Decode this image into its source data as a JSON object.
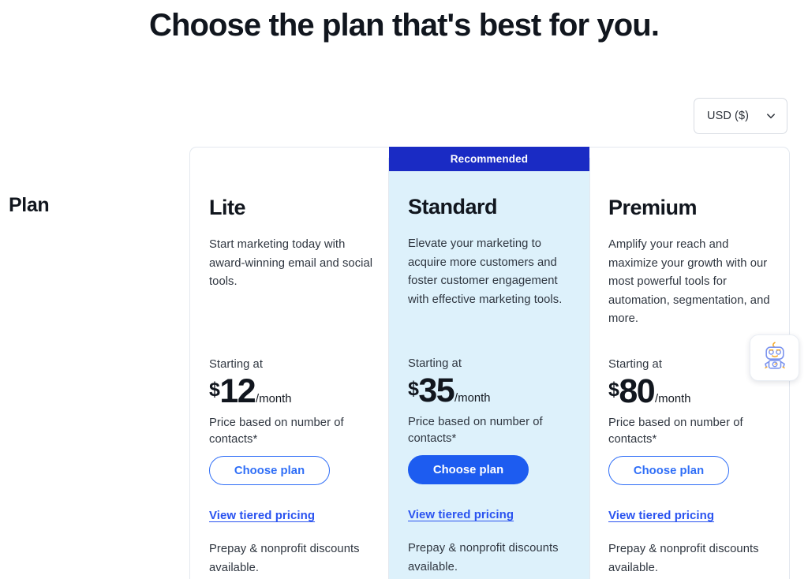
{
  "heading": "Choose the plan that's best for you.",
  "currency": {
    "selected": "USD ($)",
    "icon": "chevron-down-icon"
  },
  "row_label": "Plan",
  "ribbon_label": "Recommended",
  "chat_widget": {
    "icon": "robot-icon"
  },
  "plans": [
    {
      "id": "lite",
      "name": "Lite",
      "description": "Start marketing today with award-winning email and social tools.",
      "starting_at": "Starting at",
      "currency_symbol": "$",
      "amount": "12",
      "per": "/month",
      "price_note": "Price based on number of contacts*",
      "cta_label": "Choose plan",
      "cta_style": "outline",
      "tier_link": "View tiered pricing",
      "discount_note": "Prepay & nonprofit discounts available.",
      "recommended": false
    },
    {
      "id": "standard",
      "name": "Standard",
      "description": "Elevate your marketing to acquire more customers and foster customer engagement with effective marketing tools.",
      "starting_at": "Starting at",
      "currency_symbol": "$",
      "amount": "35",
      "per": "/month",
      "price_note": "Price based on number of contacts*",
      "cta_label": "Choose plan",
      "cta_style": "filled",
      "tier_link": "View tiered pricing",
      "discount_note": "Prepay & nonprofit discounts available.",
      "recommended": true
    },
    {
      "id": "premium",
      "name": "Premium",
      "description": "Amplify your reach and maximize your growth with our most powerful tools for automation, segmentation, and more.",
      "starting_at": "Starting at",
      "currency_symbol": "$",
      "amount": "80",
      "per": "/month",
      "price_note": "Price based on number of contacts*",
      "cta_label": "Choose plan",
      "cta_style": "outline",
      "tier_link": "View tiered pricing",
      "discount_note": "Prepay & nonprofit discounts available.",
      "recommended": false
    }
  ],
  "colors": {
    "accent_blue": "#1d5cf0",
    "ribbon_blue": "#1a2bc4",
    "standard_bg": "#ddf1fb",
    "link_blue": "#2a53f0",
    "border_gray": "#e3e8ef"
  }
}
